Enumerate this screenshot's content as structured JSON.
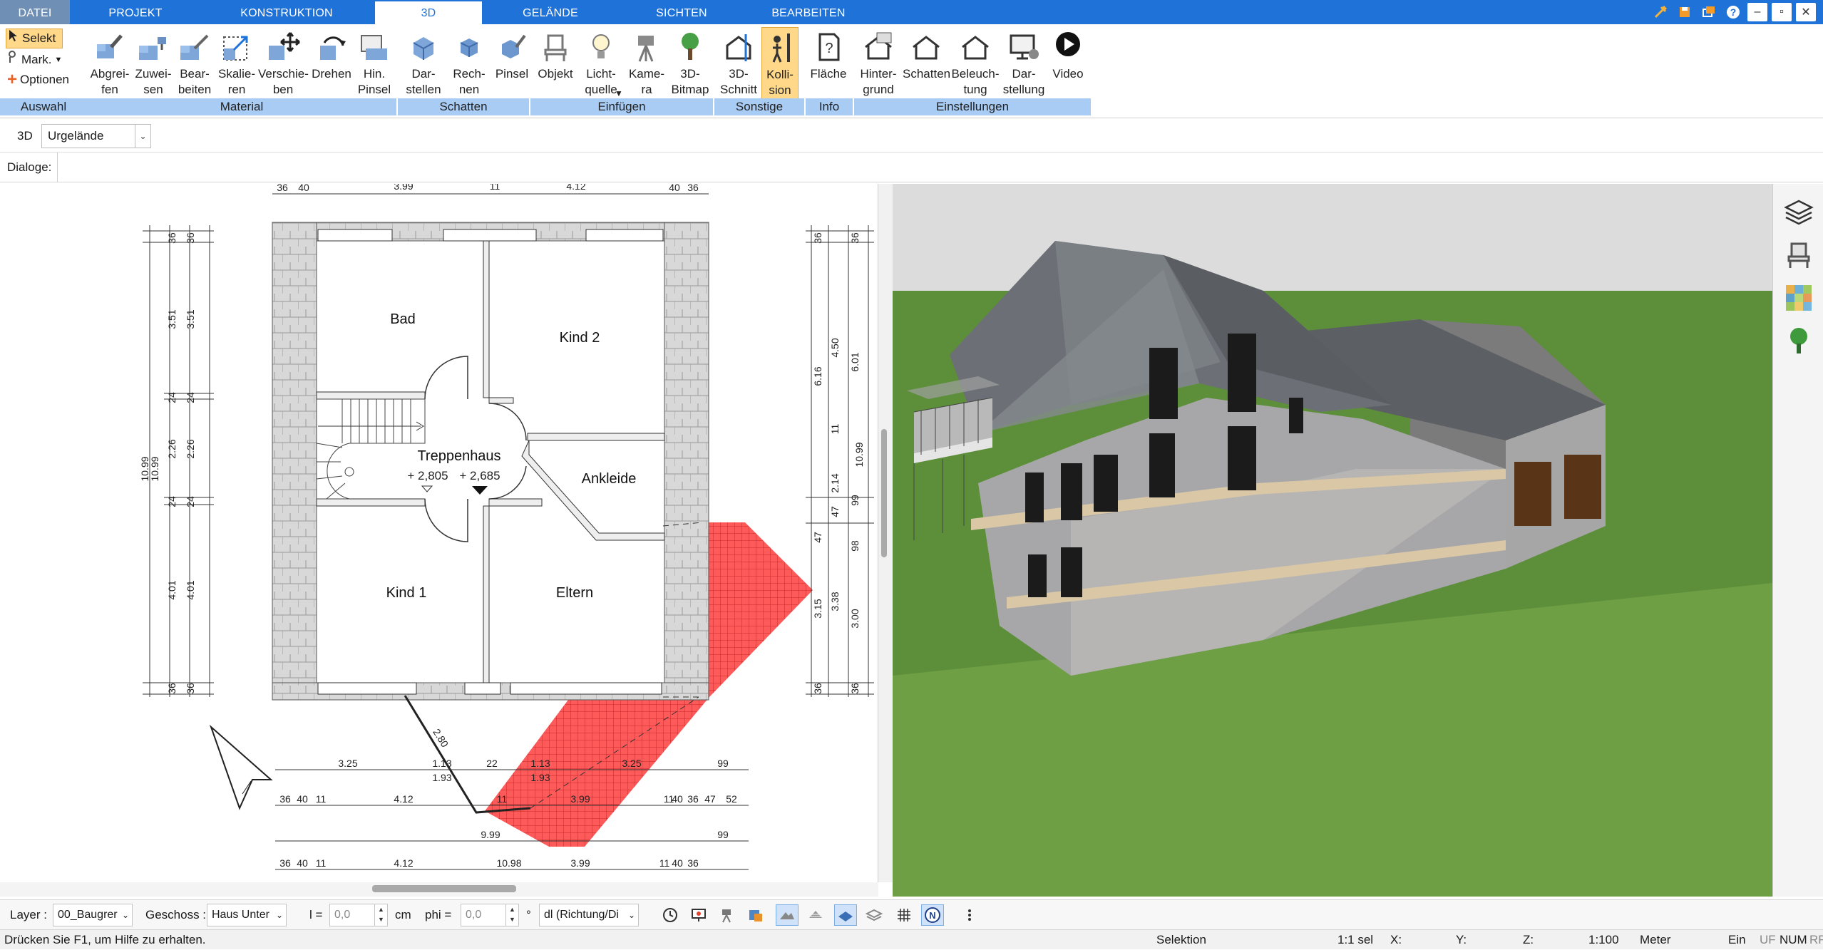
{
  "tabs": [
    {
      "label": "DATEI"
    },
    {
      "label": "PROJEKT"
    },
    {
      "label": "KONSTRUKTION"
    },
    {
      "label": "3D"
    },
    {
      "label": "GELÄNDE"
    },
    {
      "label": "SICHTEN"
    },
    {
      "label": "BEARBEITEN"
    }
  ],
  "auswahl": {
    "select": "Selekt",
    "mark": "Mark.",
    "options": "Optionen",
    "group": "Auswahl"
  },
  "ribbon_buttons": [
    {
      "label": "Abgrei-\nfen",
      "icon": "eyedropper-icon"
    },
    {
      "label": "Zuwei-\nsen",
      "icon": "assign-material-icon"
    },
    {
      "label": "Bear-\nbeiten",
      "icon": "edit-material-icon"
    },
    {
      "label": "Skalie-\nren",
      "icon": "scale-icon"
    },
    {
      "label": "Verschie-\nben",
      "icon": "move-icon"
    },
    {
      "label": "Drehen",
      "icon": "rotate-icon"
    },
    {
      "label": "Hin.\nPinsel",
      "icon": "background-brush-icon"
    },
    {
      "label": "Dar-\nstellen",
      "icon": "shadow-display-icon"
    },
    {
      "label": "Rech-\nnen",
      "icon": "shadow-calc-icon"
    },
    {
      "label": "Pinsel",
      "icon": "shadow-brush-icon"
    },
    {
      "label": "Objekt",
      "icon": "chair-icon"
    },
    {
      "label": "Licht-\nquelle",
      "icon": "bulb-icon"
    },
    {
      "label": "Kame-\nra",
      "icon": "camera-icon"
    },
    {
      "label": "3D-\nBitmap",
      "icon": "tree-icon"
    },
    {
      "label": "3D-\nSchnitt",
      "icon": "section-cut-icon"
    },
    {
      "label": "Kolli-\nsion",
      "icon": "collision-person-icon"
    },
    {
      "label": "Fläche",
      "icon": "area-info-icon"
    },
    {
      "label": "Hinter-\ngrund",
      "icon": "background-house-icon"
    },
    {
      "label": "Schatten",
      "icon": "shadow-house-icon"
    },
    {
      "label": "Beleuch-\ntung",
      "icon": "lighting-house-icon"
    },
    {
      "label": "Dar-\nstellung",
      "icon": "display-monitor-icon"
    },
    {
      "label": "Video",
      "icon": "video-play-icon"
    }
  ],
  "groups": [
    "Material",
    "Schatten",
    "Einfügen",
    "Sonstige",
    "Info",
    "Einstellungen"
  ],
  "optbar": {
    "view": "3D",
    "terrain": "Urgelände"
  },
  "dialogbar": {
    "label": "Dialoge:"
  },
  "plan": {
    "rooms": [
      "Bad",
      "Kind 2",
      "Treppenhaus",
      "Ankleide",
      "Kind 1",
      "Eltern"
    ],
    "levels": [
      "+ 2,805",
      "+ 2,685"
    ],
    "dims_left_a": [
      "36",
      "3.51",
      "24",
      "2.26",
      "24",
      "4.01",
      "36"
    ],
    "dims_left_b": [
      "36",
      "3.51",
      "24",
      "2.26",
      "24",
      "4.01",
      "36"
    ],
    "dim_total_left": [
      "10.99",
      "10.99"
    ],
    "dims_right_a": [
      "36",
      "6.16",
      "11",
      "47",
      "47",
      "98",
      "3.15",
      "36"
    ],
    "dims_right_b": [
      "36",
      "4.50",
      "6.01",
      "2.14",
      "99",
      "10.99",
      "3.38",
      "3.00",
      "36"
    ],
    "dims_top": [
      "36",
      "40",
      "3.99",
      "11",
      "4.12",
      "40",
      "36"
    ],
    "dims_bottom_1": [
      "3.25",
      "1.13",
      "1.93",
      "22",
      "1.13",
      "1.93",
      "3.25",
      "99"
    ],
    "dims_bottom_2": [
      "36",
      "40",
      "11",
      "4.12",
      "11",
      "3.99",
      "11",
      "40",
      "36",
      "47",
      "52"
    ],
    "dims_bottom_3": [
      "9.99",
      "99"
    ],
    "dims_bottom_4": [
      "36",
      "40",
      "11",
      "4.12",
      "10.98",
      "3.99",
      "11",
      "40",
      "36"
    ],
    "diag": "2.80"
  },
  "bottombar": {
    "layer_label": "Layer :",
    "layer_value": "00_Baugrer",
    "floor_label": "Geschoss :",
    "floor_value": "Haus Unter",
    "l_label": "l =",
    "l_value": "0,0",
    "l_unit": "cm",
    "phi_label": "phi =",
    "phi_value": "0,0",
    "phi_unit": "°",
    "dl_value": "dl (Richtung/Di"
  },
  "statusbar": {
    "help": "Drücken Sie F1, um Hilfe zu erhalten.",
    "mode": "Selektion",
    "sel": "1:1 sel",
    "x": "X:",
    "y": "Y:",
    "z": "Z:",
    "scale": "1:100",
    "unit": "Meter",
    "ein": "Ein",
    "uf": "UF",
    "num": "NUM",
    "rf": "RF"
  },
  "colors": {
    "accent": "#1e72d8",
    "group": "#a9ccf4",
    "highlight": "#ffd88a",
    "grass": "#5d8f3a",
    "terrace": "#ff3a3a"
  }
}
